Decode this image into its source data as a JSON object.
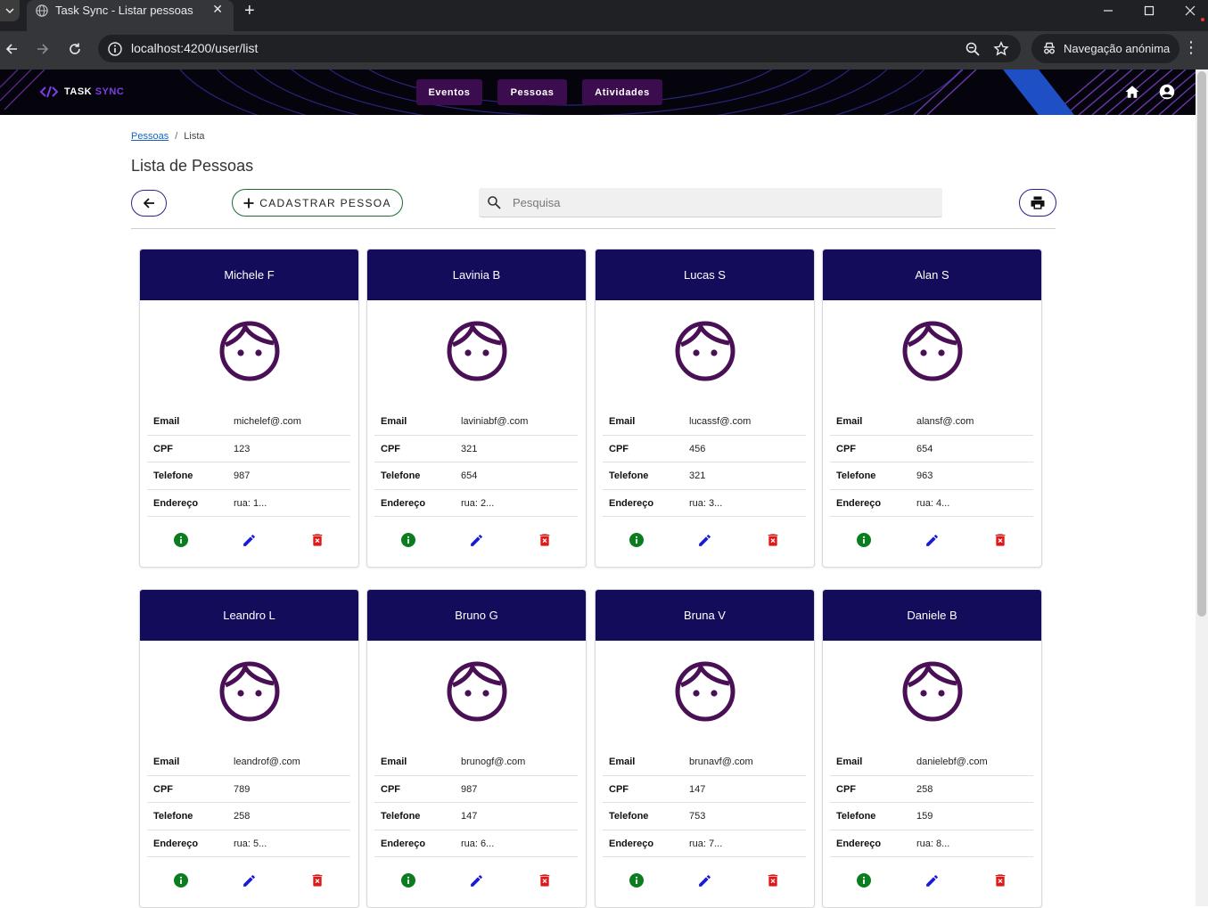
{
  "browser": {
    "tab_title": "Task Sync - Listar pessoas",
    "new_tab_icon": "plus-icon",
    "url": "localhost:4200/user/list",
    "incognito_label": "Navegação anónima"
  },
  "header": {
    "logo_part1": "TASK",
    "logo_part2": "SYNC",
    "nav": [
      "Eventos",
      "Pessoas",
      "Atividades"
    ],
    "colors": {
      "background": "#05030c",
      "nav_button": "#3b0d4e",
      "logo_accent": "#7b3fe4"
    }
  },
  "breadcrumb": {
    "root": "Pessoas",
    "separator": "/",
    "current": "Lista"
  },
  "page": {
    "title": "Lista de Pessoas",
    "add_button_label": "CADASTRAR PESSOA",
    "search_placeholder": "Pesquisa"
  },
  "field_labels": {
    "email": "Email",
    "cpf": "CPF",
    "phone": "Telefone",
    "address": "Endereço"
  },
  "people": [
    {
      "name": "Michele F",
      "email": "michelef@.com",
      "cpf": "123",
      "phone": "987",
      "address": "rua: 1..."
    },
    {
      "name": "Lavinia B",
      "email": "laviniabf@.com",
      "cpf": "321",
      "phone": "654",
      "address": "rua: 2..."
    },
    {
      "name": "Lucas S",
      "email": "lucassf@.com",
      "cpf": "456",
      "phone": "321",
      "address": "rua: 3..."
    },
    {
      "name": "Alan S",
      "email": "alansf@.com",
      "cpf": "654",
      "phone": "963",
      "address": "rua: 4..."
    },
    {
      "name": "Leandro L",
      "email": "leandrof@.com",
      "cpf": "789",
      "phone": "258",
      "address": "rua: 5..."
    },
    {
      "name": "Bruno G",
      "email": "brunogf@.com",
      "cpf": "987",
      "phone": "147",
      "address": "rua: 6..."
    },
    {
      "name": "Bruna V",
      "email": "brunavf@.com",
      "cpf": "147",
      "phone": "753",
      "address": "rua: 7..."
    },
    {
      "name": "Daniele B",
      "email": "danielebf@.com",
      "cpf": "258",
      "phone": "159",
      "address": "rua: 8..."
    }
  ],
  "card_colors": {
    "header": "#120c5a",
    "avatar": "#4a1055",
    "info_icon": "#0a7d1e",
    "edit_icon": "#1a1adb",
    "delete_icon": "#e01818"
  }
}
